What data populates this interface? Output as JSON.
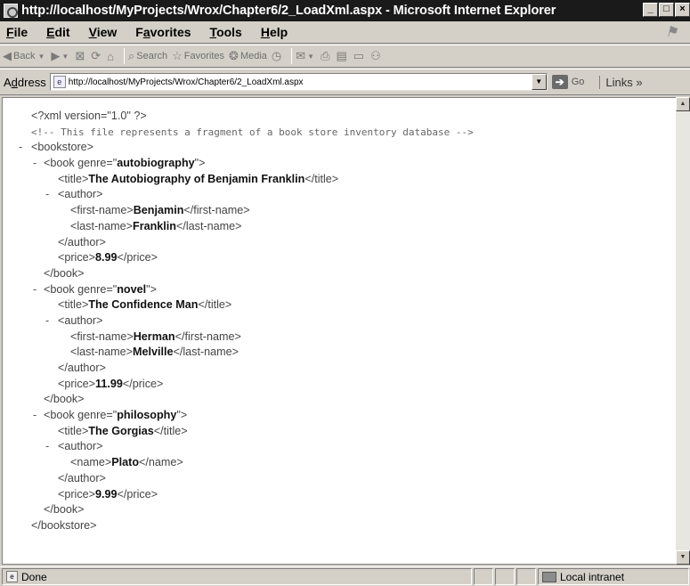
{
  "window": {
    "title": "http://localhost/MyProjects/Wrox/Chapter6/2_LoadXml.aspx - Microsoft Internet Explorer",
    "minimize": "_",
    "restore": "□",
    "close": "×"
  },
  "menu": [
    {
      "underline": "F",
      "rest": "ile"
    },
    {
      "underline": "E",
      "rest": "dit"
    },
    {
      "underline": "V",
      "rest": "iew"
    },
    {
      "pre": "F",
      "underline": "a",
      "rest": "vorites"
    },
    {
      "underline": "T",
      "rest": "ools"
    },
    {
      "underline": "H",
      "rest": "elp"
    }
  ],
  "toolbar": {
    "back": "Back",
    "search": "Search",
    "favorites": "Favorites",
    "media": "Media"
  },
  "address": {
    "label_pre": "A",
    "label_ul": "d",
    "label_rest": "dress",
    "url": "http://localhost/MyProjects/Wrox/Chapter6/2_LoadXml.aspx",
    "go": "Go",
    "links": "Links"
  },
  "xml": {
    "decl": "<?xml version=\"1.0\" ?>",
    "comment": "<!--  This file represents a fragment of a book store inventory database   -->",
    "root_open": "<bookstore>",
    "root_close": "</bookstore>",
    "books": [
      {
        "genre": "autobiography",
        "title": "The Autobiography of Benjamin Franklin",
        "author": [
          {
            "tag": "first-name",
            "value": "Benjamin"
          },
          {
            "tag": "last-name",
            "value": "Franklin"
          }
        ],
        "price": "8.99"
      },
      {
        "genre": "novel",
        "title": "The Confidence Man",
        "author": [
          {
            "tag": "first-name",
            "value": "Herman"
          },
          {
            "tag": "last-name",
            "value": "Melville"
          }
        ],
        "price": "11.99"
      },
      {
        "genre": "philosophy",
        "title": "The Gorgias",
        "author": [
          {
            "tag": "name",
            "value": "Plato"
          }
        ],
        "price": "9.99"
      }
    ]
  },
  "status": {
    "text": "Done",
    "zone": "Local intranet"
  }
}
